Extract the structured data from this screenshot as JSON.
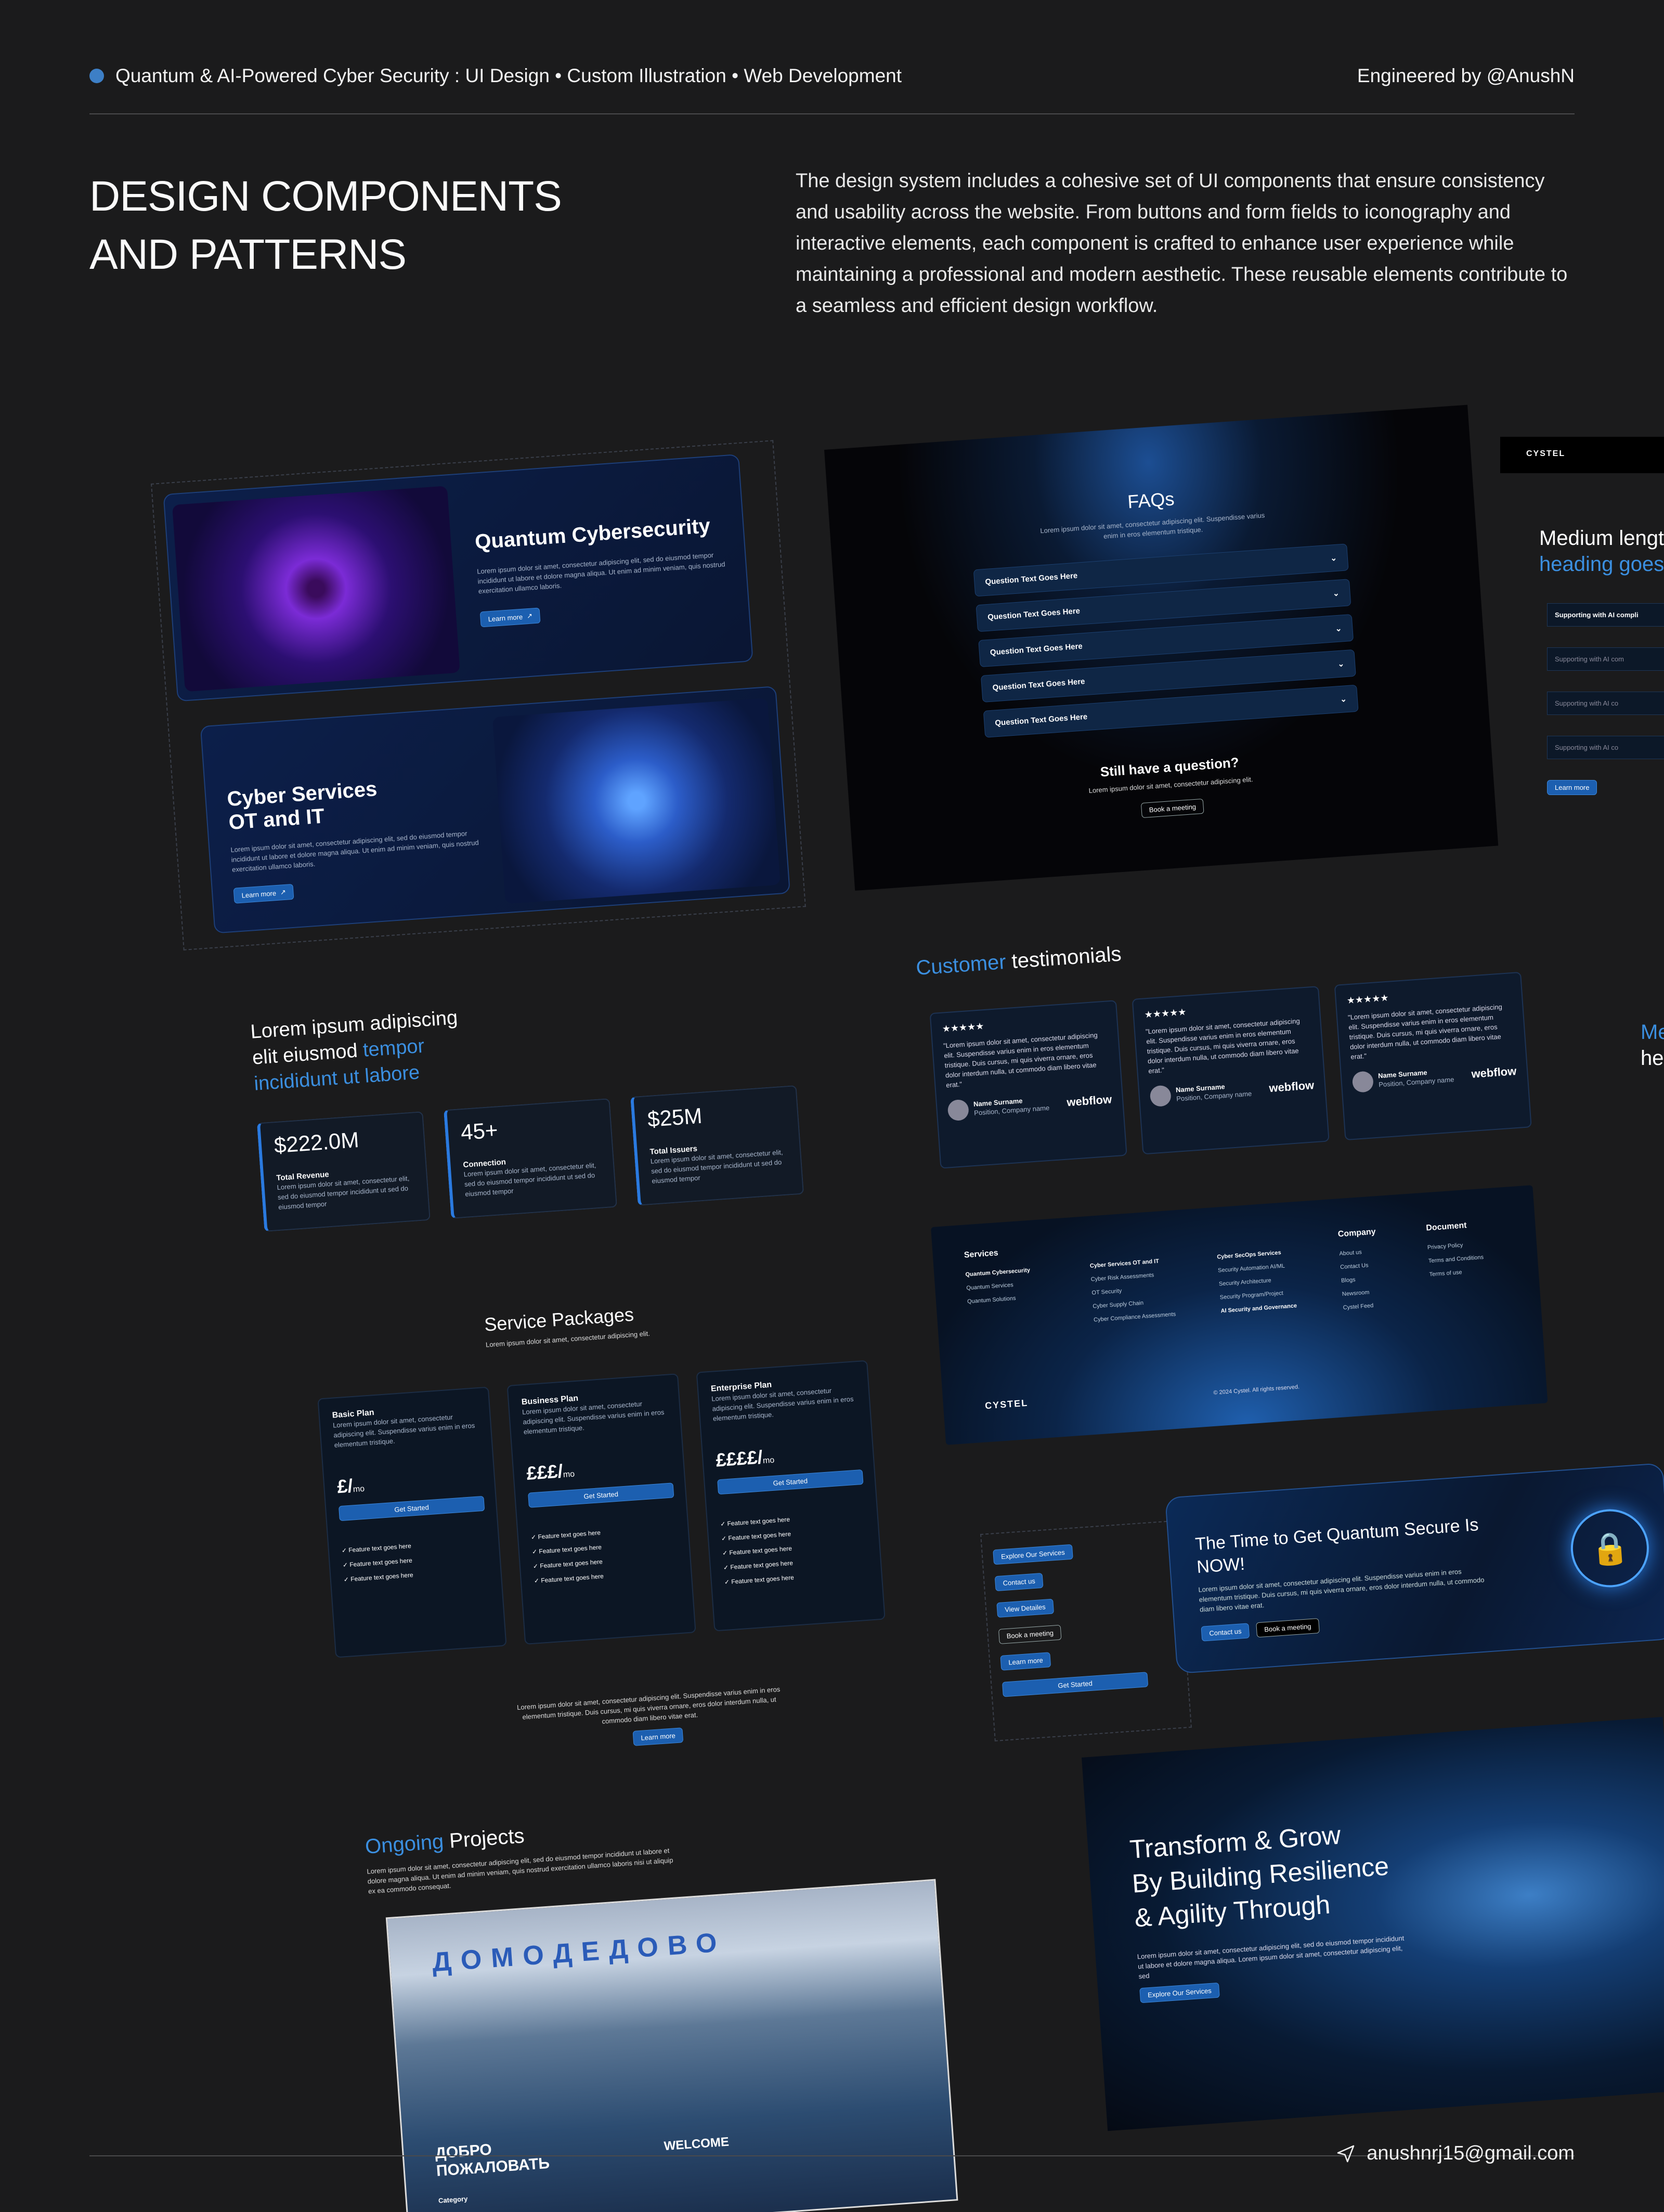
{
  "header": {
    "project_line": "Quantum & AI-Powered Cyber Security : UI Design • Custom Illustration • Web Development",
    "credit": "Engineered by @AnushN"
  },
  "section": {
    "title_line1": "DESIGN COMPONENTS",
    "title_line2": "AND PATTERNS",
    "description": "The design system includes a cohesive set of UI components that ensure consistency and usability across the website. From buttons and form fields to iconography and interactive elements, each component is crafted to enhance user experience while maintaining a professional and modern aesthetic. These reusable elements contribute to a seamless and efficient design workflow."
  },
  "feature_cards": [
    {
      "title": "Quantum Cybersecurity",
      "body": "Lorem ipsum dolor sit amet, consectetur adipiscing elit, sed do eiusmod tempor incididunt ut labore et dolore magna aliqua. Ut enim ad minim veniam, quis nostrud exercitation ullamco laboris.",
      "button": "Learn more"
    },
    {
      "title_line1": "Cyber Services",
      "title_line2": "OT and IT",
      "body": "Lorem ipsum dolor sit amet, consectetur adipiscing elit, sed do eiusmod tempor incididunt ut labore et dolore magna aliqua. Ut enim ad minim veniam, quis nostrud exercitation ullamco laboris.",
      "button": "Learn more"
    }
  ],
  "stats": {
    "heading_line1": "Lorem ipsum adipiscing",
    "heading_line2_plain": "elit eiusmod ",
    "heading_line2_accent": "tempor",
    "heading_line3_accent": "incididunt ut labore",
    "items": [
      {
        "value": "$222.0M",
        "label": "Total Revenue",
        "body": "Lorem ipsum dolor sit amet, consectetur elit, sed do eiusmod tempor incididunt ut sed do eiusmod tempor"
      },
      {
        "value": "45+",
        "label": "Connection",
        "body": "Lorem ipsum dolor sit amet, consectetur elit, sed do eiusmod tempor incididunt ut sed do eiusmod tempor"
      },
      {
        "value": "$25M",
        "label": "Total Issuers",
        "body": "Lorem ipsum dolor sit amet, consectetur elit, sed do eiusmod tempor incididunt ut sed do eiusmod tempor"
      }
    ]
  },
  "faq": {
    "title": "FAQs",
    "subtitle": "Lorem ipsum dolor sit amet, consectetur adipiscing elit. Suspendisse varius enim in eros elementum tristique.",
    "questions": [
      "Question Text Goes Here",
      "Question Text Goes Here",
      "Question Text Goes Here",
      "Question Text Goes Here",
      "Question Text Goes Here"
    ],
    "still_title": "Still have a question?",
    "still_body": "Lorem ipsum dolor sit amet, consectetur adipiscing elit.",
    "button": "Book a meeting"
  },
  "side_panel": {
    "logo": "CYSTEL",
    "heading_plain": "Medium lengt",
    "heading_accent": "heading goes",
    "items": [
      "Supporting with AI compli",
      "Supporting with AI com",
      "Supporting with AI co",
      "Supporting with AI co"
    ],
    "button": "Learn more",
    "fragment1": "Me",
    "fragment2": "he"
  },
  "testimonials": {
    "title_accent": "Customer",
    "title_plain": " testimonials",
    "stars": "★★★★★",
    "quote": "\"Lorem ipsum dolor sit amet, consectetur adipiscing elit. Suspendisse varius enim in eros elementum tristique. Duis cursus, mi quis viverra ornare, eros dolor interdum nulla, ut commodo diam libero vitae erat.\"",
    "name": "Name Surname",
    "position": "Position, Company name",
    "brand": "webflow"
  },
  "site_footer": {
    "services_heading": "Services",
    "col1": [
      "Quantum Cybersecurity",
      "Quantum Services",
      "Quantum Solutions"
    ],
    "col2": [
      "Cyber Services OT and IT",
      "Cyber Risk Assessments",
      "OT Security",
      "Cyber Supply Chain",
      "Cyber Compliance Assessments"
    ],
    "col3": [
      "Cyber SecOps Services",
      "Security Automation AI/ML",
      "Security Architecture",
      "Security Program/Project",
      "AI Security and Governance"
    ],
    "company_heading": "Company",
    "company": [
      "About us",
      "Contact Us",
      "Blogs",
      "Newsroom",
      "Cystel Feed"
    ],
    "document_heading": "Document",
    "document": [
      "Privacy Policy",
      "Terms and Conditions",
      "Terms of use"
    ],
    "logo": "CYSTEL",
    "copyright": "© 2024 Cystel. All rights reserved."
  },
  "pricing": {
    "title": "Service Packages",
    "subtitle": "Lorem ipsum dolor sit amet, consectetur adipiscing elit.",
    "plans": [
      {
        "name": "Basic Plan",
        "desc": "Lorem ipsum dolor sit amet, consectetur adipiscing elit. Suspendisse varius enim in eros elementum tristique.",
        "price": "£/",
        "unit": "mo",
        "button": "Get Started",
        "features": [
          "Feature text goes here",
          "Feature text goes here",
          "Feature text goes here"
        ]
      },
      {
        "name": "Business Plan",
        "desc": "Lorem ipsum dolor sit amet, consectetur adipiscing elit. Suspendisse varius enim in eros elementum tristique.",
        "price": "£££/",
        "unit": "mo",
        "button": "Get Started",
        "features": [
          "Feature text goes here",
          "Feature text goes here",
          "Feature text goes here",
          "Feature text goes here"
        ]
      },
      {
        "name": "Enterprise Plan",
        "desc": "Lorem ipsum dolor sit amet, consectetur adipiscing elit. Suspendisse varius enim in eros elementum tristique.",
        "price": "££££/",
        "unit": "mo",
        "button": "Get Started",
        "features": [
          "Feature text goes here",
          "Feature text goes here",
          "Feature text goes here",
          "Feature text goes here",
          "Feature text goes here"
        ]
      }
    ],
    "footnote": "Lorem ipsum dolor sit amet, consectetur adipiscing elit. Suspendisse varius enim in eros elementum tristique. Duis cursus, mi quis viverra ornare, eros dolor interdum nulla, ut commodo diam libero vitae erat.",
    "button": "Learn more"
  },
  "button_palette": [
    "Explore Our Services",
    "Contact us",
    "View Detailes",
    "Book a meeting",
    "Learn more",
    "Get Started"
  ],
  "cta": {
    "title": "The Time to Get Quantum Secure Is NOW!",
    "body": "Lorem ipsum dolor sit amet, consectetur adipiscing elit. Suspendisse varius enim in eros elementum tristique. Duis cursus, mi quis viverra ornare, eros dolor interdum nulla, ut commodo diam libero vitae erat.",
    "primary": "Contact us",
    "secondary": "Book a meeting"
  },
  "projects": {
    "title_accent": "Ongoing",
    "title_plain": " Projects",
    "body": "Lorem ipsum dolor sit amet, consectetur adipiscing elit, sed do eiusmod tempor incididunt ut labore et dolore magna aliqua. Ut enim ad minim veniam, quis nostrud exercitation ullamco laboris nisi ut aliquip ex ea commodo consequat.",
    "sign": "ДОМОДЕДОВО",
    "welcome_ru": "ДОБРО ПОЖАЛОВАТЬ",
    "welcome_en": "WELCOME",
    "category": "Category"
  },
  "hero": {
    "title_line1": "Transform & Grow",
    "title_line2": "By Building Resilience",
    "title_line3": "& Agility Through",
    "body": "Lorem ipsum dolor sit amet, consectetur adipiscing elit, sed do eiusmod tempor incididunt ut labore et dolore magna aliqua. Lorem ipsum dolor sit amet, consectetur adipiscing elit, sed",
    "button": "Explore Our Services"
  },
  "footer": {
    "email": "anushnrj15@gmail.com"
  },
  "colors": {
    "background": "#1b1b1c",
    "accent": "#3b8fe0",
    "dot": "#3d7fc6"
  }
}
